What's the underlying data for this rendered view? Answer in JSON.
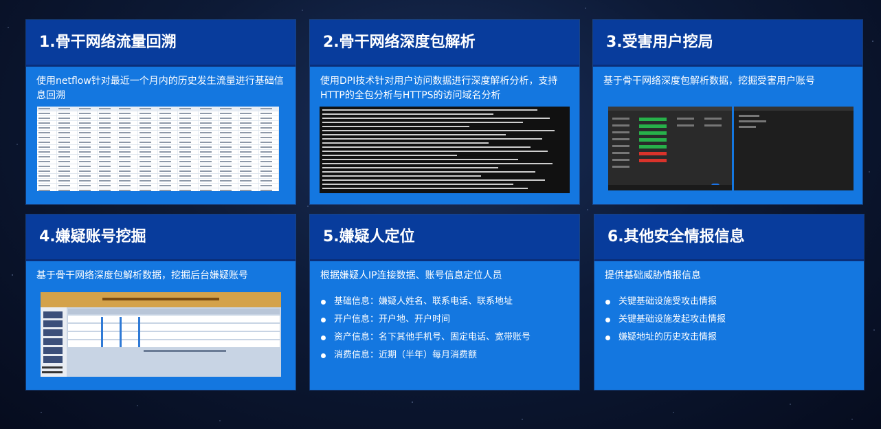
{
  "cards": [
    {
      "title": "1.骨干网络流量回溯",
      "desc": "使用netflow针对最近一个月内的历史发生流量进行基础信息回溯",
      "thumb": "spreadsheet-screenshot"
    },
    {
      "title": "2.骨干网络深度包解析",
      "desc": "使用DPI技术针对用户访问数据进行深度解析分析，支持HTTP的全包分析与HTTPS的访问域名分析",
      "thumb": "terminal-log-screenshot"
    },
    {
      "title": "3.受害用户挖局",
      "desc": "基于骨干网络深度包解析数据，挖掘受害用户账号",
      "thumb": "dashboard-screenshot"
    },
    {
      "title": "4.嫌疑账号挖掘",
      "desc": "基于骨干网络深度包解析数据，挖掘后台嫌疑账号",
      "thumb": "web-admin-screenshot"
    },
    {
      "title": "5.嫌疑人定位",
      "desc": "根据嫌疑人IP连接数据、账号信息定位人员",
      "items": [
        "基础信息：嫌疑人姓名、联系电话、联系地址",
        "开户信息：开户地、开户时间",
        "资产信息：名下其他手机号、固定电话、宽带账号",
        "消费信息：近期（半年）每月消费额"
      ]
    },
    {
      "title": "6.其他安全情报信息",
      "desc": "提供基础威胁情报信息",
      "items": [
        "关键基础设施受攻击情报",
        "关键基础设施发起攻击情报",
        "嫌疑地址的历史攻击情报"
      ]
    }
  ],
  "colors": {
    "card_bg": "#1477e0",
    "header_bg": "#083c9c",
    "page_bg": "#0d1a36"
  }
}
